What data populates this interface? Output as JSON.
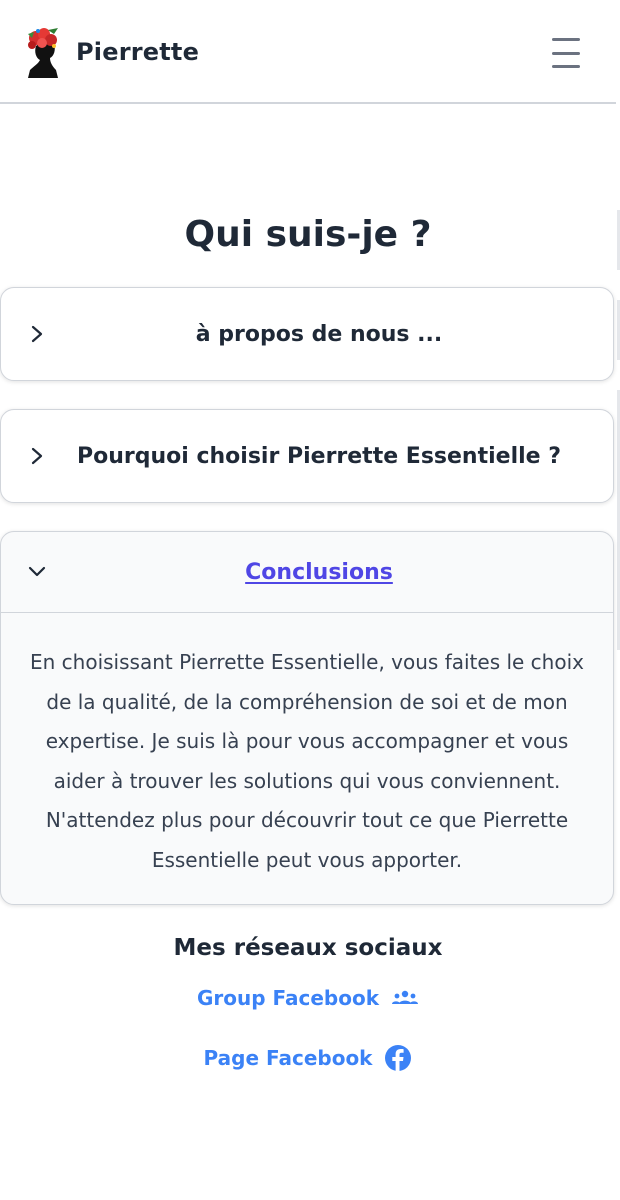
{
  "header": {
    "brand_name": "Pierrette",
    "logo_icon": "woman-flower-silhouette-logo",
    "menu_icon": "hamburger-menu-icon"
  },
  "main": {
    "title": "Qui suis-je ?"
  },
  "accordion": {
    "items": [
      {
        "title": "à propos de nous ...",
        "expanded": false,
        "icon": "chevron-right-icon"
      },
      {
        "title": "Pourquoi choisir Pierrette Essentielle ?",
        "expanded": false,
        "icon": "chevron-right-icon"
      },
      {
        "title": "Conclusions",
        "expanded": true,
        "icon": "chevron-down-icon",
        "body": "En choisissant Pierrette Essentielle, vous faites le choix de la qualité, de la compréhension de soi et de mon expertise. Je suis là pour vous accompagner et vous aider à trouver les solutions qui vous conviennent. N'attendez plus pour découvrir tout ce que Pierrette Essentielle peut vous apporter."
      }
    ]
  },
  "social": {
    "title": "Mes réseaux sociaux",
    "links": [
      {
        "label": "Group Facebook",
        "icon": "users-group-icon"
      },
      {
        "label": "Page Facebook",
        "icon": "facebook-icon"
      }
    ]
  },
  "colors": {
    "text": "#1f2937",
    "link_accent": "#4f46e5",
    "social_link": "#3b82f6",
    "border": "#d1d5db"
  }
}
